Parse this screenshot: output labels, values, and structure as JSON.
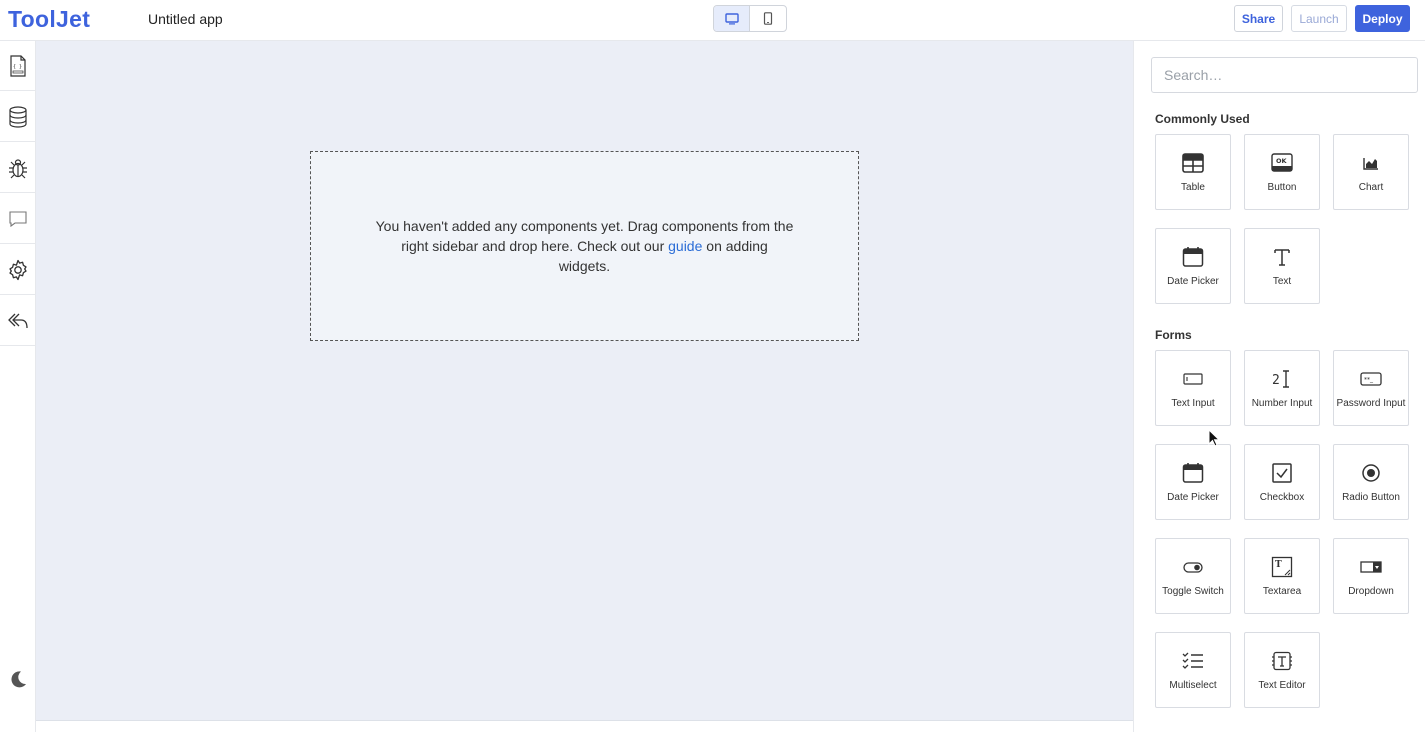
{
  "header": {
    "logo": "ToolJet",
    "app_name": "Untitled app",
    "share_label": "Share",
    "launch_label": "Launch",
    "deploy_label": "Deploy"
  },
  "colors": {
    "accent": "#3e63dd",
    "canvas_bg": "#ebeef6",
    "link": "#2a6cd6"
  },
  "leftbar": {
    "items": [
      "page-icon",
      "database-icon",
      "bug-icon",
      "comment-icon",
      "settings-icon",
      "undo-icon"
    ],
    "bottom": "moon-icon"
  },
  "canvas": {
    "empty_text_before": "You haven't added any components yet. Drag components from the right sidebar and drop here. Check out our ",
    "empty_link": "guide",
    "empty_text_after": " on adding widgets."
  },
  "sidebar": {
    "search_placeholder": "Search…",
    "commonly_used_title": "Commonly Used",
    "commonly_used": [
      "Table",
      "Button",
      "Chart",
      "Date Picker",
      "Text"
    ],
    "forms_title": "Forms",
    "forms": [
      "Text Input",
      "Number Input",
      "Password Input",
      "Date Picker",
      "Checkbox",
      "Radio Button",
      "Toggle Switch",
      "Textarea",
      "Dropdown",
      "Multiselect",
      "Text Editor"
    ]
  }
}
